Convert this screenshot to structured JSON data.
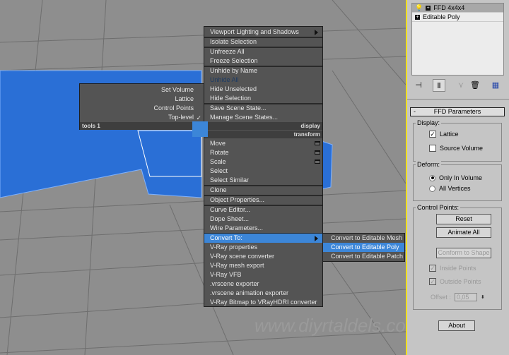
{
  "quad_left": {
    "items": [
      {
        "label": "Set Volume"
      },
      {
        "label": "Lattice"
      },
      {
        "label": "Control Points"
      },
      {
        "label": "Top-level",
        "checked": true
      }
    ],
    "footer": "tools 1"
  },
  "quad_right": {
    "items": [
      {
        "label": "Viewport Lighting and Shadows",
        "submenu": true
      },
      {
        "label": "Isolate Selection"
      },
      {
        "label": "Unfreeze All"
      },
      {
        "label": "Freeze Selection"
      },
      {
        "label": "Unhide by Name"
      },
      {
        "label": "Unhide All",
        "disabled": true
      },
      {
        "label": "Hide Unselected"
      },
      {
        "label": "Hide Selection"
      },
      {
        "label": "Save Scene State..."
      },
      {
        "label": "Manage Scene States..."
      }
    ],
    "footer_display": "display",
    "footer_transform": "transform",
    "transform_items": [
      {
        "label": "Move",
        "options": true
      },
      {
        "label": "Rotate",
        "options": true
      },
      {
        "label": "Scale",
        "options": true
      },
      {
        "label": "Select"
      },
      {
        "label": "Select Similar"
      },
      {
        "label": "Clone"
      },
      {
        "label": "Object Properties..."
      },
      {
        "label": "Curve Editor..."
      },
      {
        "label": "Dope Sheet..."
      },
      {
        "label": "Wire Parameters..."
      },
      {
        "label": "Convert To:",
        "submenu": true,
        "highlighted": true
      },
      {
        "label": "V-Ray properties"
      },
      {
        "label": "V-Ray scene converter"
      },
      {
        "label": "V-Ray mesh export"
      },
      {
        "label": "V-Ray VFB"
      },
      {
        "label": ".vrscene exporter"
      },
      {
        "label": ".vrscene animation exporter"
      },
      {
        "label": "V-Ray Bitmap to VRayHDRI converter"
      }
    ]
  },
  "submenu": {
    "items": [
      {
        "label": "Convert to Editable Mesh"
      },
      {
        "label": "Convert to Editable Poly",
        "highlighted": true
      },
      {
        "label": "Convert to Editable Patch"
      }
    ]
  },
  "panel": {
    "stack": [
      {
        "label": "FFD 4x4x4",
        "selected": true
      },
      {
        "label": "Editable Poly"
      }
    ],
    "rollout_title": "FFD Parameters",
    "display": {
      "title": "Display:",
      "lattice": "Lattice",
      "lattice_checked": true,
      "source_volume": "Source Volume",
      "source_volume_checked": false
    },
    "deform": {
      "title": "Deform:",
      "only_in_volume": "Only In Volume",
      "all_vertices": "All Vertices",
      "selected": "Only In Volume"
    },
    "control_points": {
      "title": "Control Points:",
      "reset": "Reset",
      "animate_all": "Animate All",
      "conform": "Conform to Shape",
      "inside": "Inside Points",
      "outside": "Outside Points",
      "offset_label": "Offset :",
      "offset_value": "0,05"
    },
    "about": "About"
  },
  "watermark": "www.diyrtaldels.com",
  "colors": {
    "highlight": "#3c86d8",
    "viewport_border": "#f0e020",
    "object": "#2a6fd6"
  }
}
